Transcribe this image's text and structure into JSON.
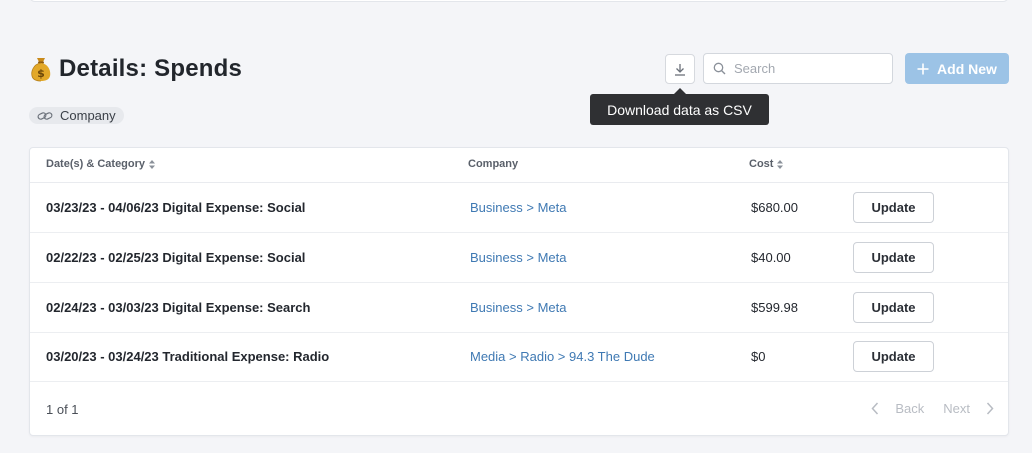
{
  "header": {
    "title": "Details: Spends",
    "icon": "money-bag-icon"
  },
  "toolbar": {
    "download_icon": "download-icon",
    "search_placeholder": "Search",
    "search_value": "",
    "add_new_label": "Add New",
    "add_new_color": "#9cc3e6"
  },
  "tooltip": {
    "text": "Download data as CSV"
  },
  "tag": {
    "label": "Company",
    "icon": "link-icon"
  },
  "table": {
    "columns": [
      "Date(s) & Category",
      "Company",
      "Cost"
    ],
    "rows": [
      {
        "date_category": "03/23/23 - 04/06/23 Digital Expense: Social",
        "company": "Business > Meta",
        "cost": "$680.00",
        "action": "Update"
      },
      {
        "date_category": "02/22/23 - 02/25/23 Digital Expense: Social",
        "company": "Business > Meta",
        "cost": "$40.00",
        "action": "Update"
      },
      {
        "date_category": "02/24/23 - 03/03/23 Digital Expense: Search",
        "company": "Business > Meta",
        "cost": "$599.98",
        "action": "Update"
      },
      {
        "date_category": "03/20/23 - 03/24/23 Traditional Expense: Radio",
        "company": "Media > Radio > 94.3 The Dude",
        "cost": "$0",
        "action": "Update"
      }
    ]
  },
  "pagination": {
    "count": "1 of 1",
    "back_label": "Back",
    "next_label": "Next"
  },
  "colors": {
    "link": "#3f79b3",
    "background": "#f4f5f8",
    "tooltip_bg": "#2f3033"
  }
}
